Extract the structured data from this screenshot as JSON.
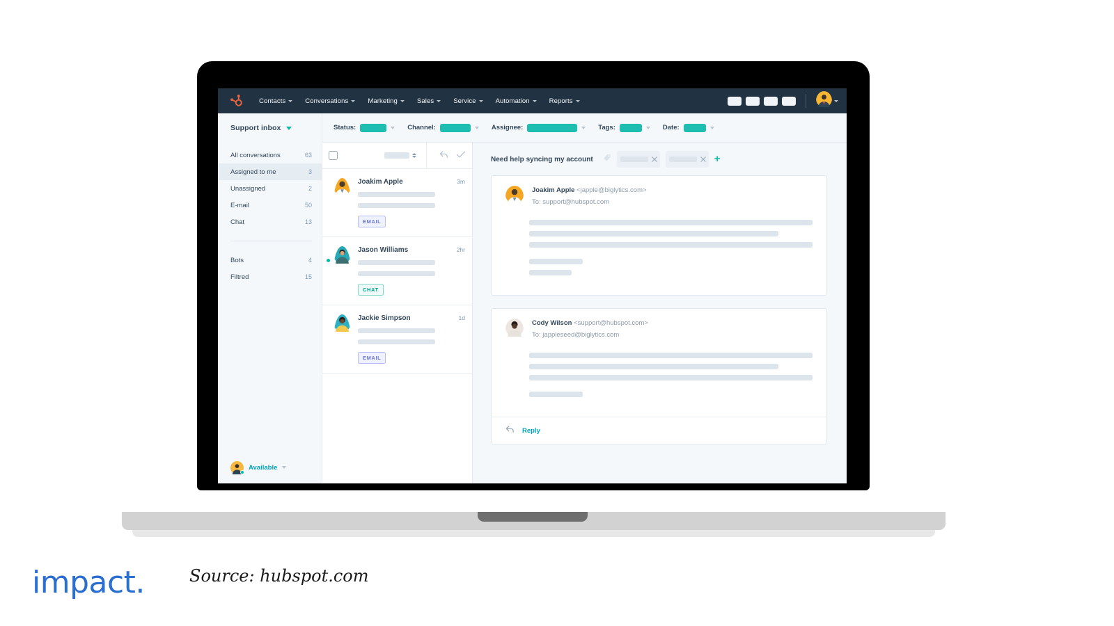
{
  "topnav": {
    "logo_icon": "hubspot-sprocket-icon",
    "items": [
      {
        "label": "Contacts",
        "caret": true
      },
      {
        "label": "Conversations",
        "caret": true
      },
      {
        "label": "Marketing",
        "caret": true
      },
      {
        "label": "Sales",
        "caret": true
      },
      {
        "label": "Service",
        "caret": true
      },
      {
        "label": "Automation",
        "caret": true
      },
      {
        "label": "Reports",
        "caret": true
      }
    ],
    "right_pills": 4,
    "avatar_icon": "user-avatar"
  },
  "filterbar": {
    "filters": [
      {
        "label": "Status:",
        "value_width": 38
      },
      {
        "label": "Channel:",
        "value_width": 44
      },
      {
        "label": "Assignee:",
        "value_width": 72
      },
      {
        "label": "Tags:",
        "value_width": 32
      },
      {
        "label": "Date:",
        "value_width": 32
      }
    ]
  },
  "sidebar": {
    "header": "Support inbox",
    "items": [
      {
        "label": "All conversations",
        "count": "63",
        "active": false
      },
      {
        "label": "Assigned to me",
        "count": "3",
        "active": true
      },
      {
        "label": "Unassigned",
        "count": "2",
        "active": false
      },
      {
        "label": "E-mail",
        "count": "50",
        "active": false
      },
      {
        "label": "Chat",
        "count": "13",
        "active": false
      }
    ],
    "items2": [
      {
        "label": "Bots",
        "count": "4",
        "active": false
      },
      {
        "label": "Filtred",
        "count": "15",
        "active": false
      }
    ],
    "status": {
      "label": "Available",
      "dot_color": "#00bda5"
    }
  },
  "convlist": {
    "toolbar": {
      "select_all_checkbox": "unchecked",
      "sort_placeholder_width": 36,
      "icons": [
        "reply-arrow-icon",
        "checkmark-icon"
      ]
    },
    "conversations": [
      {
        "name": "Joakim Apple",
        "time": "3m",
        "badge": "EMAIL",
        "badge_type": "email",
        "unread": false,
        "selected": true,
        "preview_widths": [
          72,
          72
        ],
        "avatar_color": "#f5a623"
      },
      {
        "name": "Jason Williams",
        "time": "2hr",
        "badge": "CHAT",
        "badge_type": "chat",
        "unread": true,
        "selected": false,
        "preview_widths": [
          72,
          72
        ],
        "avatar_color": "#27a9b5"
      },
      {
        "name": "Jackie Simpson",
        "time": "1d",
        "badge": "EMAIL",
        "badge_type": "email",
        "unread": false,
        "selected": false,
        "preview_widths": [
          72,
          72
        ],
        "avatar_color": "#2bb0c4"
      }
    ]
  },
  "thread": {
    "title": "Need help syncing my account",
    "tag_icon": "tag-icon",
    "tags": [
      {
        "remove_icon": "close-icon"
      },
      {
        "remove_icon": "close-icon"
      }
    ],
    "add_tag_label": "+",
    "messages": [
      {
        "from_name": "Joakim Apple",
        "from_address": "<japple@biglytics.com>",
        "to": "To: support@hubspot.com",
        "avatar_color": "#f5a623",
        "body_long": [
          100,
          88,
          100
        ],
        "body_short": [
          19,
          15
        ],
        "has_footer": false
      },
      {
        "from_name": "Cody Wilson",
        "from_address": "<support@hubspot.com>",
        "to": "To: jappleseed@biglytics.com",
        "avatar_color": "#4a3a33",
        "body_long": [
          100,
          88,
          100
        ],
        "body_short": [
          19
        ],
        "has_footer": true,
        "footer_label": "Reply",
        "footer_icon": "reply-arrow-icon"
      }
    ]
  },
  "caption": {
    "brand": "impact.",
    "source": "Source: hubspot.com"
  },
  "colors": {
    "nav_bg": "#213343",
    "accent_teal": "#00bda5",
    "filter_pill": "#1dbdb0",
    "link_teal": "#00a4bd",
    "text_dark": "#33475b",
    "text_muted": "#7c98b6",
    "placeholder": "#dde4ec",
    "app_bg": "#f5f8fa",
    "badge_email": "#6a78d1",
    "badge_chat": "#00a38c",
    "brand_blue": "#2a6fd0"
  }
}
